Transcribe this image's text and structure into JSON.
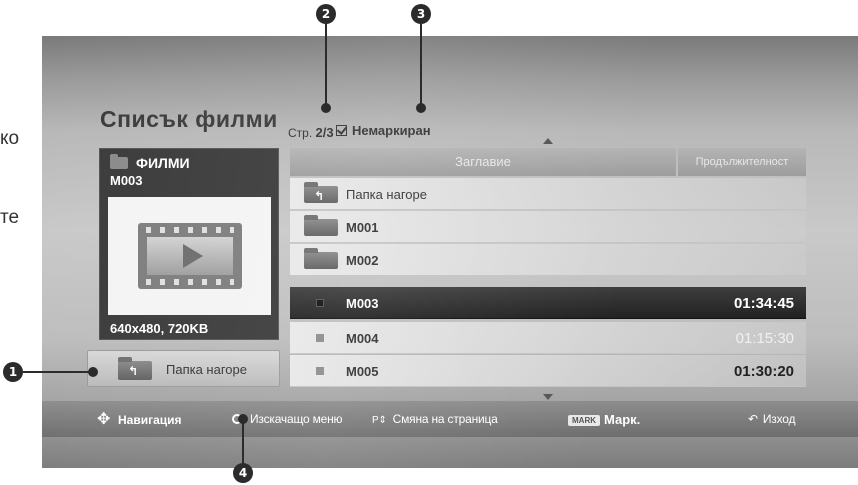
{
  "side_text": [
    "ко",
    "те"
  ],
  "callouts": [
    "1",
    "2",
    "3",
    "4"
  ],
  "header": {
    "title": "Списък филми",
    "page_prefix": "Стр.",
    "page_value": "2/3",
    "filter_label": "Немаркиран"
  },
  "preview": {
    "folder_label": "ФИЛМИ",
    "file_name": "M003",
    "resolution": "640x480, 720KB",
    "up_folder_label": "Папка нагоре"
  },
  "table": {
    "col_title": "Заглавие",
    "col_duration": "Продължителност",
    "rows": [
      {
        "type": "up-folder",
        "name": "Папка нагоре",
        "duration": ""
      },
      {
        "type": "folder",
        "name": "M001",
        "duration": ""
      },
      {
        "type": "folder",
        "name": "M002",
        "duration": ""
      },
      {
        "type": "file",
        "name": "M003",
        "duration": "01:34:45",
        "selected": true
      },
      {
        "type": "file",
        "name": "M004",
        "duration": "01:15:30"
      },
      {
        "type": "file",
        "name": "M005",
        "duration": "01:30:20"
      }
    ]
  },
  "bottom_bar": {
    "navigation": "Навигация",
    "popup_menu": "Изскачащо меню",
    "page_change": "Смяна на страница",
    "mark_key": "MARK",
    "mark": "Марк.",
    "exit": "Изход"
  }
}
